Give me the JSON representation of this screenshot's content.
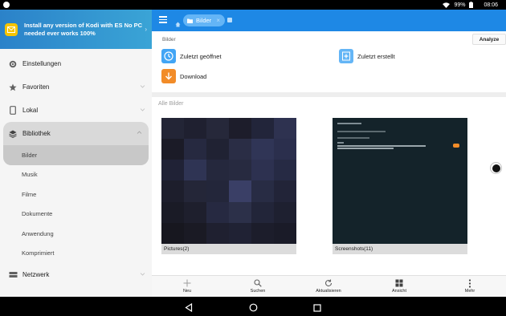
{
  "status": {
    "battery": "99%",
    "time": "08:06"
  },
  "sidebar": {
    "promo_text": "Install any version of Kodi with ES No PC needed ever works 100%",
    "items": [
      {
        "label": "Einstellungen",
        "icon": "gear-icon"
      },
      {
        "label": "Favoriten",
        "icon": "star-icon"
      },
      {
        "label": "Lokal",
        "icon": "phone-icon"
      },
      {
        "label": "Bibliothek",
        "icon": "layers-icon"
      },
      {
        "label": "Netzwerk",
        "icon": "network-icon"
      }
    ],
    "library_sub": [
      "Bilder",
      "Musik",
      "Filme",
      "Dokumente",
      "Anwendung",
      "Komprimiert"
    ]
  },
  "topbar": {
    "tab_label": "Bilder"
  },
  "content": {
    "section_title": "Bilder",
    "analyze_label": "Analyze",
    "shortcuts": {
      "recent_opened": "Zuletzt geöffnet",
      "recent_created": "Zuletzt erstellt",
      "download": "Download"
    },
    "all_label": "Alle Bilder",
    "albums": [
      {
        "name": "Pictures",
        "count": "(2)"
      },
      {
        "name": "Screenshots",
        "count": "(11)"
      }
    ]
  },
  "toolbar": {
    "new": "Neu",
    "search": "Suchen",
    "refresh": "Aktualisieren",
    "view": "Ansicht",
    "more": "Mehr"
  },
  "colors": {
    "accent": "#1e88e5",
    "download": "#f28c28",
    "shortcut_blue": "#42a5f5"
  }
}
